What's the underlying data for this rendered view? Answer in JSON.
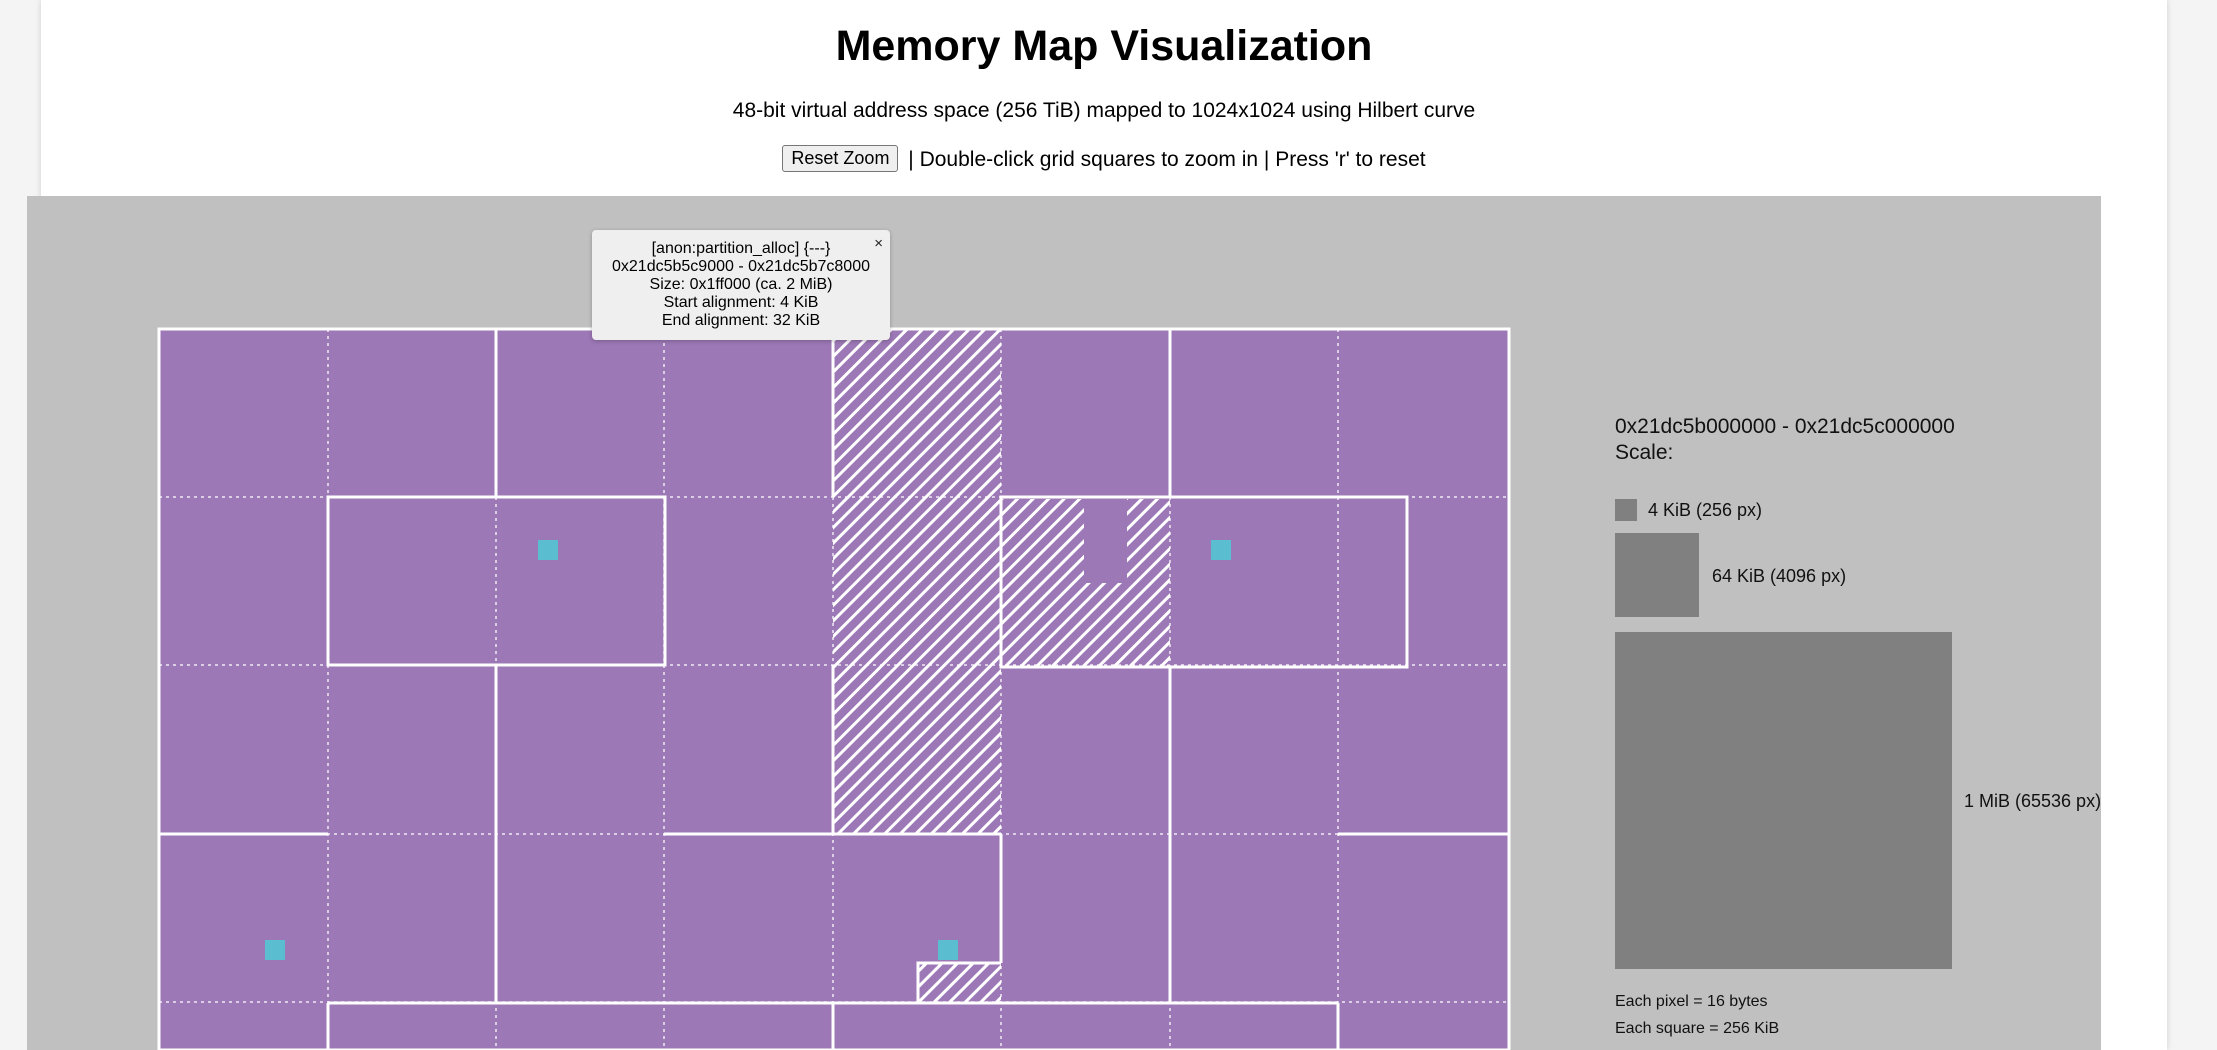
{
  "header": {
    "title": "Memory Map Visualization",
    "subtitle": "48-bit virtual address space (256 TiB) mapped to 1024x1024 using Hilbert curve",
    "reset_label": "Reset Zoom",
    "hint": "| Double-click grid squares to zoom in | Press 'r' to reset"
  },
  "tooltip": {
    "line1": "[anon:partition_alloc] {---}",
    "line2": "0x21dc5b5c9000 - 0x21dc5b7c8000",
    "line3": "Size: 0x1ff000 (ca. 2 MiB)",
    "line4": "Start alignment: 4 KiB",
    "line5": "End alignment: 32 KiB",
    "close": "×"
  },
  "legend": {
    "range": "0x21dc5b000000 - 0x21dc5c000000",
    "scale": "Scale:",
    "small": "4 KiB (256 px)",
    "medium": "64 KiB (4096 px)",
    "large": "1 MiB (65536 px)",
    "note1": "Each pixel = 16 bytes",
    "note2": "Each square = 256 KiB"
  },
  "colors": {
    "page_bg": "#f4f4f4",
    "viz_bg": "#c0c0c0",
    "region_fill": "#9c78b6",
    "marker": "#5bbed0",
    "hatch": "#ffffff",
    "scale_box": "#808080"
  }
}
